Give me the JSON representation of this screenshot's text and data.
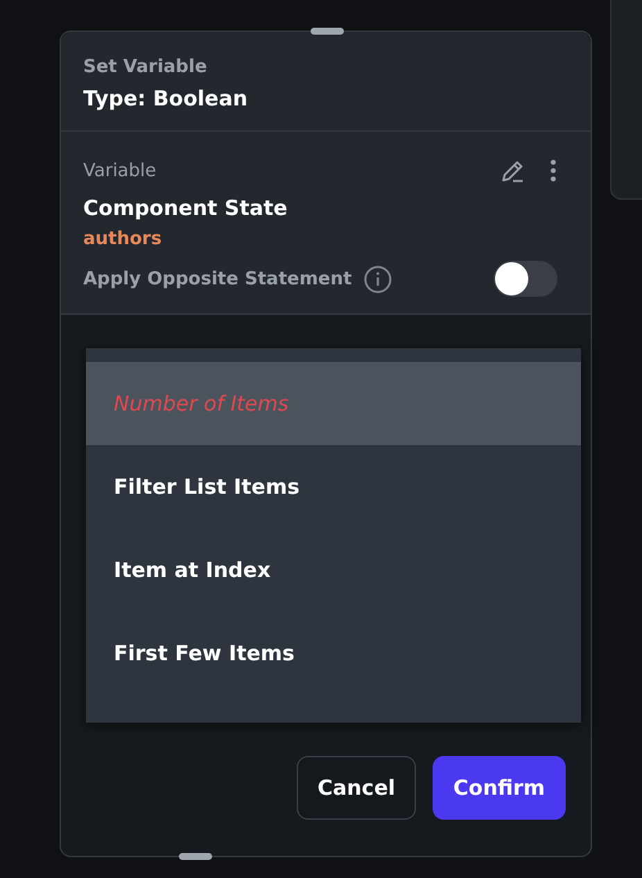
{
  "header": {
    "subtitle": "Set Variable",
    "title": "Type: Boolean"
  },
  "variable": {
    "label": "Variable",
    "name": "Component State",
    "field": "authors"
  },
  "opposite": {
    "label": "Apply Opposite Statement",
    "on": false
  },
  "dropdown": {
    "options": [
      {
        "label": "Number of Items",
        "selected": true
      },
      {
        "label": "Filter List Items",
        "selected": false
      },
      {
        "label": "Item at Index",
        "selected": false
      },
      {
        "label": "First Few Items",
        "selected": false
      }
    ]
  },
  "buttons": [
    {
      "label": "Cancel",
      "kind": "secondary"
    },
    {
      "label": "Confirm",
      "kind": "primary"
    }
  ]
}
